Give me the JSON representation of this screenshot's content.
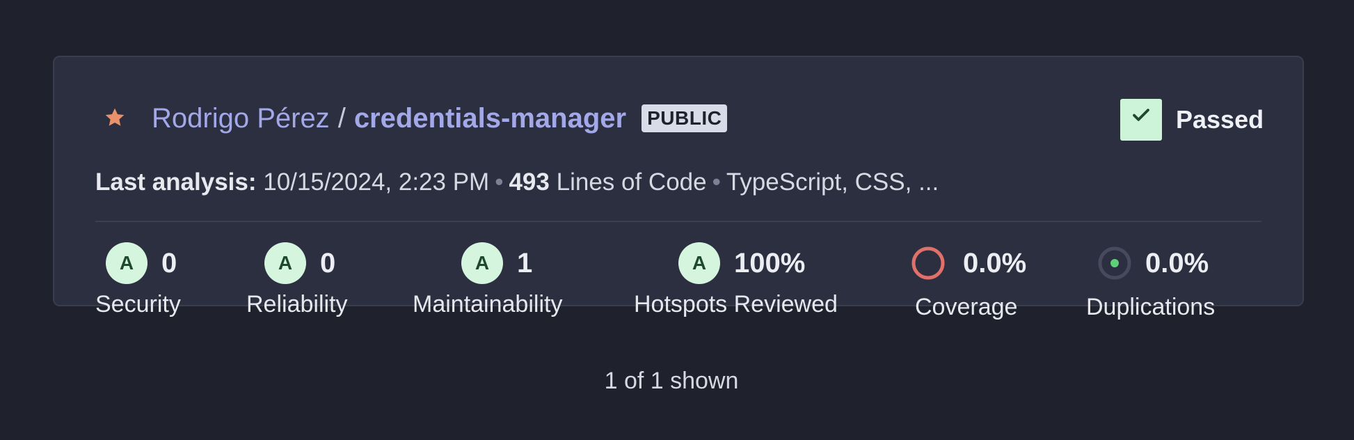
{
  "project": {
    "owner": "Rodrigo Pérez",
    "separator": "/",
    "name": "credentials-manager",
    "visibility": "PUBLIC",
    "favorite_icon": "star-icon",
    "favorite_color": "#e8916a"
  },
  "quality_gate": {
    "status": "Passed",
    "icon": "check-icon",
    "color": "#cdf3d8"
  },
  "analysis": {
    "last_analysis_label": "Last analysis:",
    "last_analysis_value": "10/15/2024, 2:23 PM",
    "bullet": "•",
    "lines_of_code": "493",
    "lines_of_code_label": "Lines of Code",
    "languages": "TypeScript, CSS, ..."
  },
  "metrics": {
    "security": {
      "grade": "A",
      "value": "0",
      "label": "Security"
    },
    "reliability": {
      "grade": "A",
      "value": "0",
      "label": "Reliability"
    },
    "maintainability": {
      "grade": "A",
      "value": "1",
      "label": "Maintainability"
    },
    "hotspots": {
      "grade": "A",
      "value": "100%",
      "label": "Hotspots Reviewed"
    },
    "coverage": {
      "value": "0.0%",
      "label": "Coverage",
      "indicator_color": "#e0706a"
    },
    "duplications": {
      "value": "0.0%",
      "label": "Duplications",
      "indicator_color": "#5fd07a"
    }
  },
  "footer": {
    "count_text": "1 of 1 shown"
  }
}
